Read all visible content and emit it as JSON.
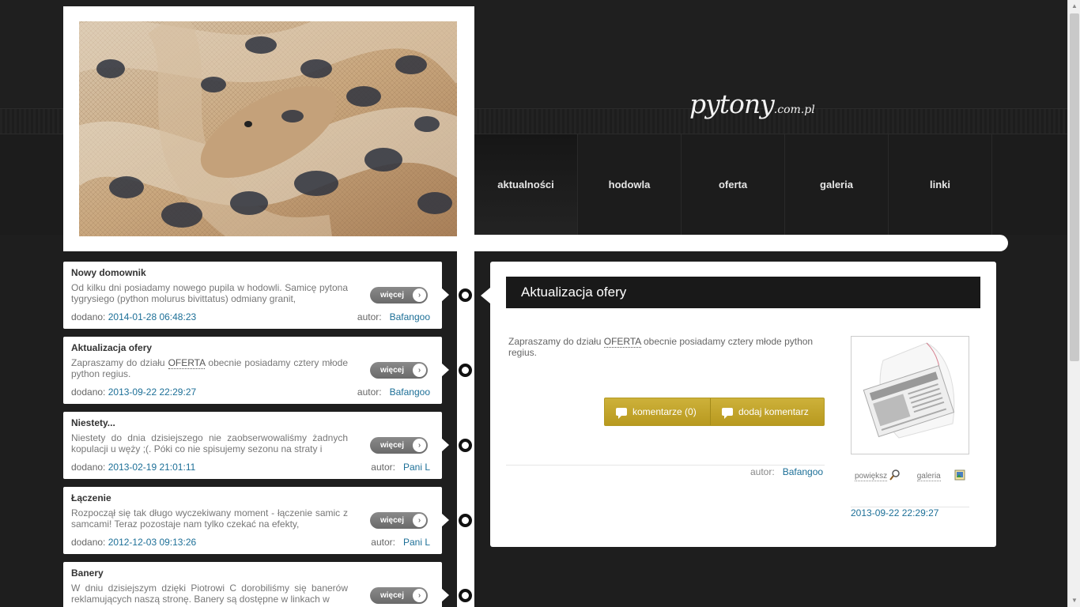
{
  "logo": {
    "main": "pytony",
    "suffix": ".com.pl"
  },
  "nav": [
    {
      "label": "aktualności"
    },
    {
      "label": "hodowla"
    },
    {
      "label": "oferta"
    },
    {
      "label": "galeria"
    },
    {
      "label": "linki"
    }
  ],
  "news": [
    {
      "title": "Nowy domownik",
      "text": "Od kilku dni posiadamy nowego pupila w hodowli. Samicę pytona tygrysiego (python molurus bivittatus) odmiany granit,",
      "more": "więcej",
      "date_label": "dodano:",
      "date": "2014-01-28 06:48:23",
      "author_label": "autor:",
      "author": "Bafangoo"
    },
    {
      "title": "Aktualizacja ofery",
      "text_pre": "Zapraszamy do działu ",
      "text_link": "OFERTA",
      "text_post": " obecnie posiadamy cztery młode python regius.",
      "more": "więcej",
      "date_label": "dodano:",
      "date": "2013-09-22 22:29:27",
      "author_label": "autor:",
      "author": "Bafangoo"
    },
    {
      "title": "Niestety...",
      "text": "Niestety do dnia dzisiejszego nie zaobserwowaliśmy żadnych kopulacji u węży ;(. Póki co nie spisujemy sezonu na straty i",
      "more": "więcej",
      "date_label": "dodano:",
      "date": "2013-02-19 21:01:11",
      "author_label": "autor:",
      "author": "Pani L"
    },
    {
      "title": "Łączenie",
      "text": "Rozpoczął się tak długo wyczekiwany moment - łączenie samic z samcami! Teraz pozostaje nam tylko czekać na efekty,",
      "more": "więcej",
      "date_label": "dodano:",
      "date": "2012-12-03 09:13:26",
      "author_label": "autor:",
      "author": "Pani L"
    },
    {
      "title": "Banery",
      "text": "W dniu dzisiejszym dzięki Piotrowi C dorobiliśmy się banerów reklamujących naszą stronę. Banery są dostępne w linkach w",
      "more": "więcej"
    }
  ],
  "detail": {
    "title": "Aktualizacja ofery",
    "text_pre": "Zapraszamy do działu ",
    "text_link": "OFERTA",
    "text_post": " obecnie posiadamy cztery młode python regius.",
    "comments_button": "komentarze (0)",
    "add_comment_button": "dodaj komentarz",
    "author_label": "autor:",
    "author": "Bafangoo",
    "zoom_label": "powiększ",
    "gallery_label": "galeria",
    "date": "2013-09-22 22:29:27"
  },
  "colors": {
    "accent_link": "#1c6f97",
    "gold_button": "#c4a62c",
    "background": "#1e1e1e"
  }
}
